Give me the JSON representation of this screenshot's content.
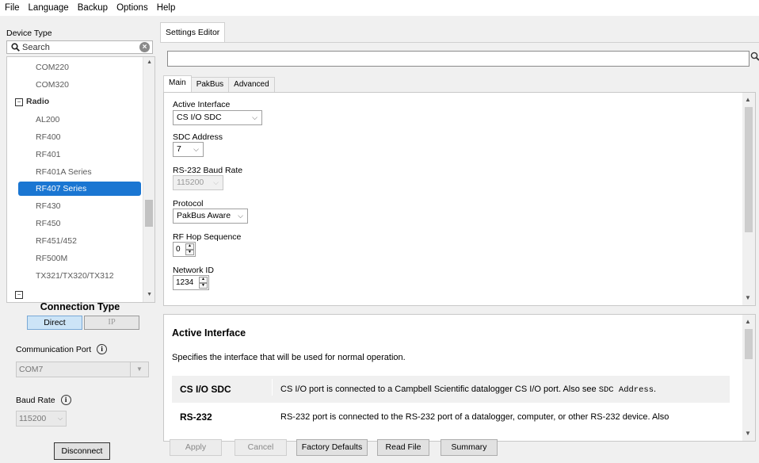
{
  "menu": [
    "File",
    "Language",
    "Backup",
    "Options",
    "Help"
  ],
  "left": {
    "device_type_label": "Device Type",
    "search_placeholder": "Search",
    "device_items": [
      {
        "label": "COM220",
        "kind": "item"
      },
      {
        "label": "COM320",
        "kind": "item"
      },
      {
        "label": "Radio",
        "kind": "group"
      },
      {
        "label": "AL200",
        "kind": "item"
      },
      {
        "label": "RF400",
        "kind": "item"
      },
      {
        "label": "RF401",
        "kind": "item"
      },
      {
        "label": "RF401A Series",
        "kind": "item"
      },
      {
        "label": "RF407 Series",
        "kind": "selected"
      },
      {
        "label": "RF430",
        "kind": "item"
      },
      {
        "label": "RF450",
        "kind": "item"
      },
      {
        "label": "RF451/452",
        "kind": "item"
      },
      {
        "label": "RF500M",
        "kind": "item"
      },
      {
        "label": "TX321/TX320/TX312",
        "kind": "item"
      }
    ],
    "connection_type_title": "Connection Type",
    "direct_label": "Direct",
    "ip_label": "IP",
    "comm_port_label": "Communication Port",
    "comm_port_value": "COM7",
    "baud_rate_label": "Baud Rate",
    "baud_rate_value": "115200",
    "disconnect_label": "Disconnect"
  },
  "editor": {
    "tab_label": "Settings Editor",
    "sub_tabs": [
      "Main",
      "PakBus",
      "Advanced"
    ],
    "fields": {
      "active_interface_label": "Active Interface",
      "active_interface_value": "CS I/O SDC",
      "sdc_address_label": "SDC Address",
      "sdc_address_value": "7",
      "baud_label": "RS-232 Baud Rate",
      "baud_value": "115200",
      "protocol_label": "Protocol",
      "protocol_value": "PakBus Aware",
      "hop_label": "RF Hop Sequence",
      "hop_value": "0",
      "network_label": "Network ID",
      "network_value": "1234"
    },
    "help": {
      "title": "Active Interface",
      "description": "Specifies the interface that will be used for normal operation.",
      "row1_key": "CS I/O SDC",
      "row1_text": "CS I/O port is connected to a Campbell Scientific datalogger CS I/O port. Also see ",
      "row1_code": "SDC Address",
      "row1_end": ".",
      "row2_key": "RS-232",
      "row2_text": "RS-232 port is connected to the RS-232 port of a datalogger, computer, or other RS-232 device. Also"
    },
    "buttons": {
      "apply": "Apply",
      "cancel": "Cancel",
      "factory": "Factory Defaults",
      "read_file": "Read File",
      "summary": "Summary"
    }
  }
}
